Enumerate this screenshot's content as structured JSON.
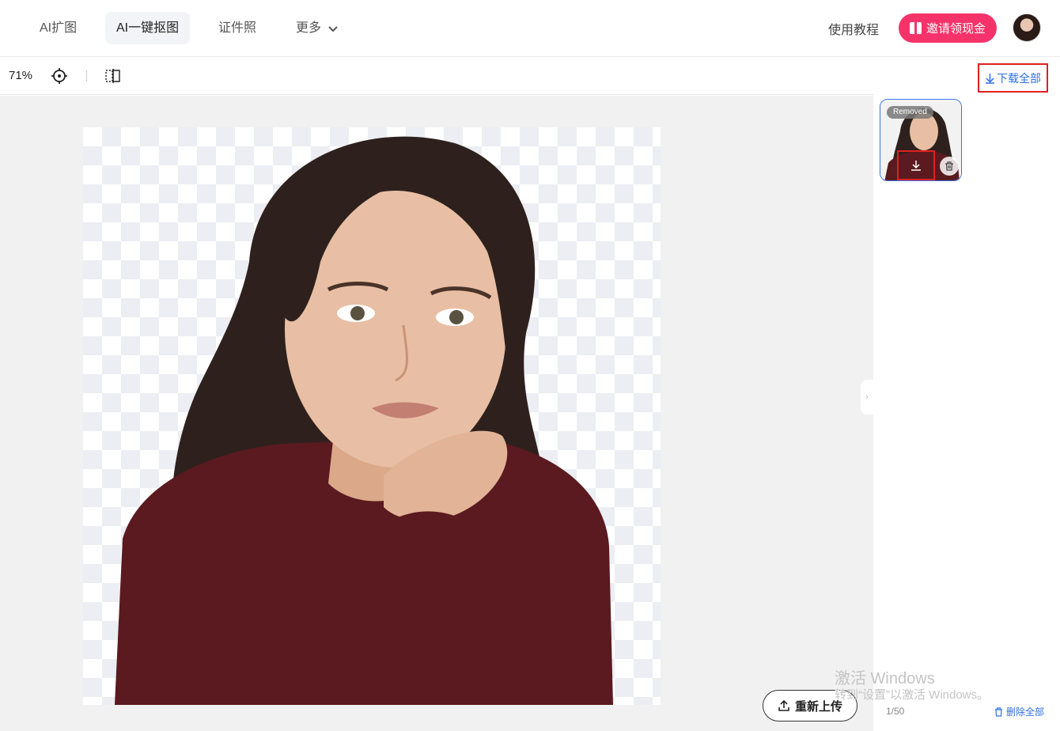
{
  "nav": {
    "items": [
      {
        "label": "AI扩图"
      },
      {
        "label": "AI一键抠图"
      },
      {
        "label": "证件照"
      },
      {
        "label": "更多"
      }
    ],
    "tutorial": "使用教程",
    "invite": "邀请领现金"
  },
  "toolbar": {
    "zoom": "71%"
  },
  "canvas": {
    "reupload": "重新上传"
  },
  "panel": {
    "download_all": "下载全部",
    "thumb_badge": "Removed",
    "count": "1/50",
    "delete_all": "删除全部"
  },
  "watermark": {
    "line1": "激活 Windows",
    "line2": "转到“设置”以激活 Windows。"
  },
  "colors": {
    "accent": "#f5336a",
    "link": "#2f6fe5",
    "highlight": "#e02020"
  }
}
